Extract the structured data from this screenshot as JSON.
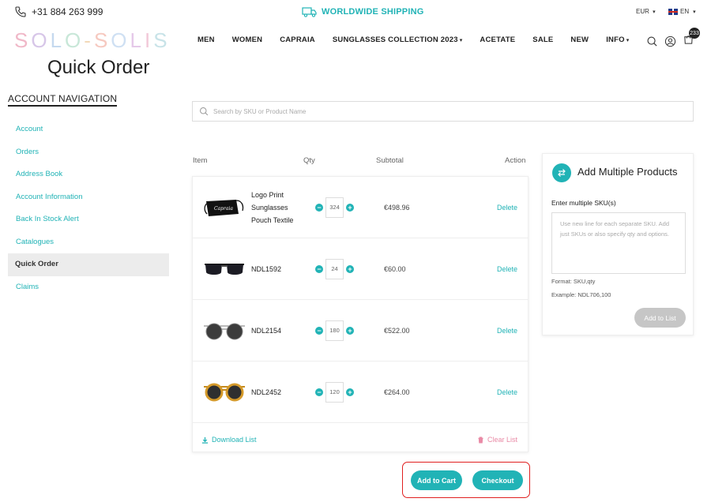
{
  "topbar": {
    "phone": "+31 884 263 999",
    "shipping": "WORLDWIDE SHIPPING",
    "currency": "EUR",
    "language": "EN"
  },
  "brand": {
    "logo_letters": [
      "S",
      "O",
      "L",
      "O",
      "-",
      "S",
      "O",
      "L",
      "I",
      "S"
    ]
  },
  "nav": {
    "items": [
      {
        "label": "MEN",
        "caret": ""
      },
      {
        "label": "WOMEN",
        "caret": ""
      },
      {
        "label": "CAPRAIA",
        "caret": ""
      },
      {
        "label": "SUNGLASSES COLLECTION 2023",
        "caret": "▾"
      },
      {
        "label": "ACETATE",
        "caret": ""
      },
      {
        "label": "SALE",
        "caret": ""
      },
      {
        "label": "NEW",
        "caret": ""
      },
      {
        "label": "INFO",
        "caret": "▾"
      }
    ],
    "cart_count": "233"
  },
  "page": {
    "title": "Quick Order"
  },
  "sidebar": {
    "title": "ACCOUNT NAVIGATION",
    "items": [
      {
        "label": "Account"
      },
      {
        "label": "Orders"
      },
      {
        "label": "Address Book"
      },
      {
        "label": "Account Information"
      },
      {
        "label": "Back In Stock Alert"
      },
      {
        "label": "Catalogues"
      },
      {
        "label": "Quick Order"
      },
      {
        "label": "Claims"
      }
    ]
  },
  "search": {
    "placeholder": "Search by SKU or Product Name"
  },
  "table": {
    "headers": {
      "item": "Item",
      "qty": "Qty",
      "subtotal": "Subtotal",
      "action": "Action"
    },
    "rows": [
      {
        "name": "Logo Print Sunglasses Pouch Textile",
        "qty": "324",
        "subtotal": "€498.96",
        "action": "Delete",
        "image": "pouch"
      },
      {
        "name": "NDL1592",
        "qty": "24",
        "subtotal": "€60.00",
        "action": "Delete",
        "image": "sunglasses-black"
      },
      {
        "name": "NDL2154",
        "qty": "180",
        "subtotal": "€522.00",
        "action": "Delete",
        "image": "sunglasses-round-grey"
      },
      {
        "name": "NDL2452",
        "qty": "120",
        "subtotal": "€264.00",
        "action": "Delete",
        "image": "sunglasses-tortoise"
      }
    ],
    "download_label": "Download List",
    "clear_label": "Clear List"
  },
  "actions": {
    "add_to_cart": "Add to Cart",
    "checkout": "Checkout"
  },
  "multi": {
    "title": "Add Multiple Products",
    "label": "Enter multiple SKU(s)",
    "placeholder": "Use new line for each separate SKU. Add just SKUs or also specify qty and options.",
    "format": "Format: SKU,qty",
    "example": "Example: NDL706,100",
    "add_label": "Add to List"
  },
  "colors": {
    "accent": "#21b3b6",
    "clear": "#e98aa6",
    "highlight_box": "#e02020"
  }
}
